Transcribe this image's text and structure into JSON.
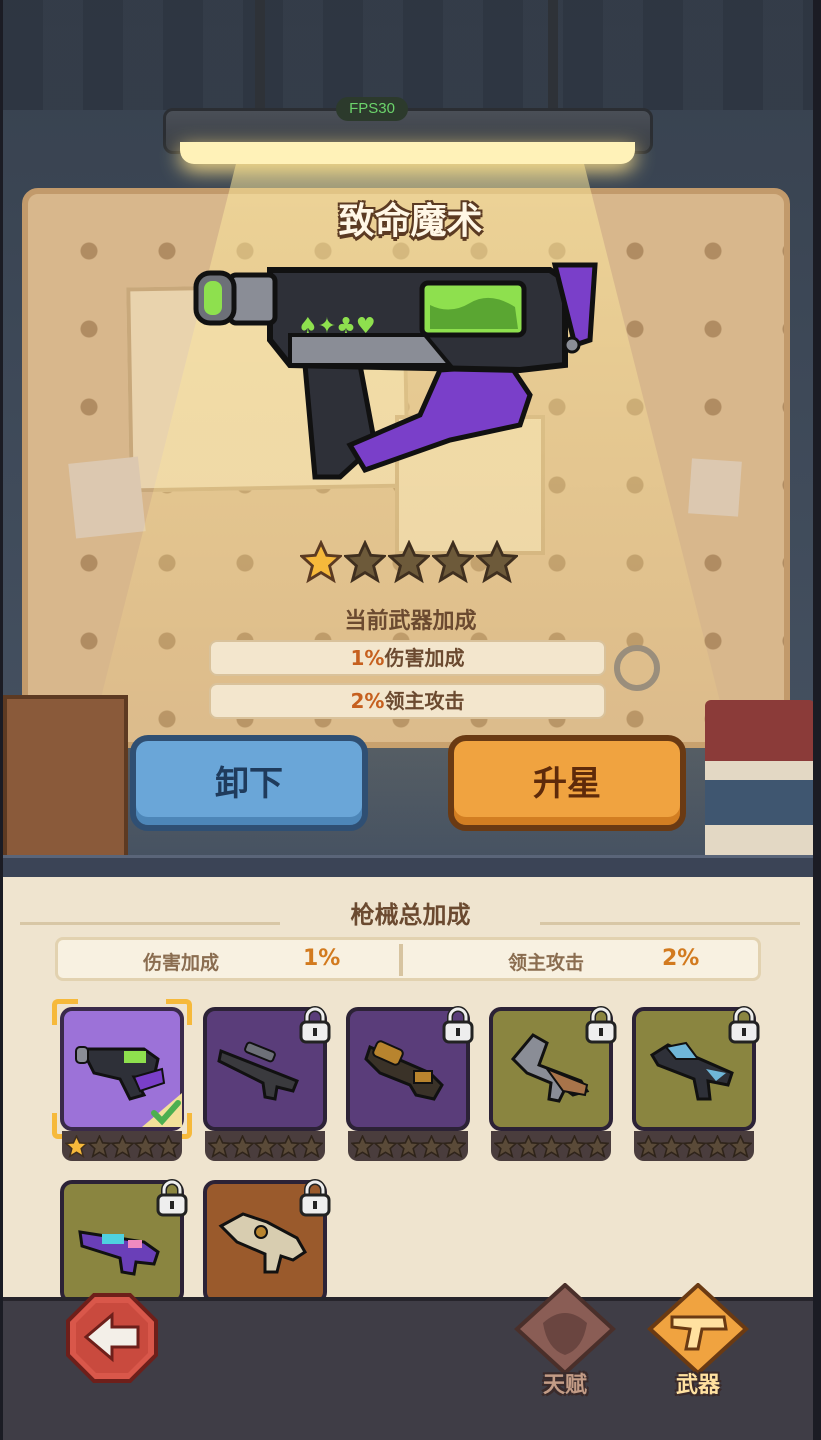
{
  "hud": {
    "fps": "FPS30"
  },
  "weapon_detail": {
    "name": "致命魔术",
    "star_rating": {
      "filled": 1,
      "total": 5
    },
    "bonus_heading": "当前武器加成",
    "bonuses": [
      {
        "value": "1%",
        "label": "伤害加成"
      },
      {
        "value": "2%",
        "label": "领主攻击"
      }
    ],
    "buttons": {
      "unequip": "卸下",
      "upgrade": "升星"
    }
  },
  "collection": {
    "title": "枪械总加成",
    "summary": [
      {
        "label": "伤害加成",
        "value": "1%"
      },
      {
        "label": "领主攻击",
        "value": "2%"
      }
    ],
    "slots": [
      {
        "icon": "magic-smg-icon",
        "rarity_color": "#9c72d8",
        "selected": true,
        "locked": false,
        "stars": 1
      },
      {
        "icon": "sniper-rifle-icon",
        "rarity_color": "#5a3d7a",
        "selected": false,
        "locked": true,
        "stars": 0
      },
      {
        "icon": "grenade-launcher-icon",
        "rarity_color": "#5a3d7a",
        "selected": false,
        "locked": true,
        "stars": 0
      },
      {
        "icon": "blunderbuss-icon",
        "rarity_color": "#8a8540",
        "selected": false,
        "locked": true,
        "stars": 0
      },
      {
        "icon": "ice-rifle-icon",
        "rarity_color": "#8a8540",
        "selected": false,
        "locked": true,
        "stars": 0
      },
      {
        "icon": "plasma-blaster-icon",
        "rarity_color": "#8a8540",
        "selected": false,
        "locked": true,
        "stars": 0
      },
      {
        "icon": "bone-cannon-icon",
        "rarity_color": "#9a5a2c",
        "selected": false,
        "locked": true,
        "stars": 0
      }
    ]
  },
  "nav": {
    "back": "back-arrow-icon",
    "tabs": [
      {
        "label": "天赋",
        "icon": "talent-mask-icon",
        "active": false
      },
      {
        "label": "武器",
        "icon": "pistol-icon",
        "active": true
      }
    ]
  },
  "colors": {
    "accent_orange": "#f0a340",
    "accent_blue": "#6aa6d8",
    "star_gold": "#f6b93b",
    "text_brown": "#6b4a30"
  }
}
